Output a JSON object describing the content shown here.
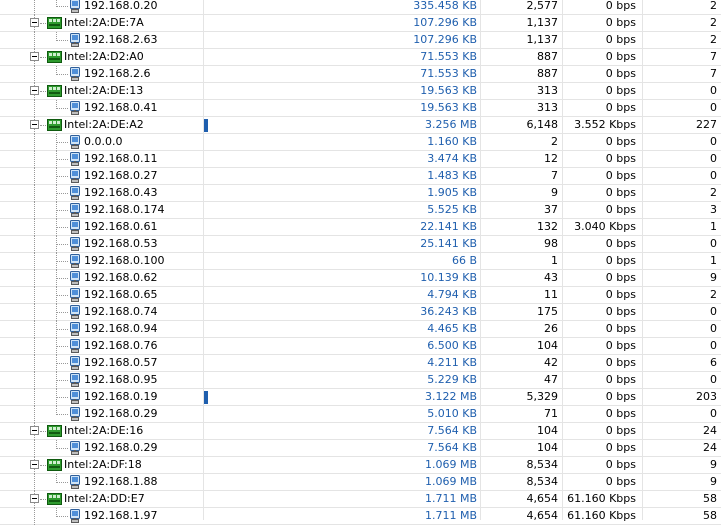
{
  "rows": [
    {
      "type": "host",
      "name": "192.168.0.20",
      "bytes": "335.458 KB",
      "packets": "2,577",
      "bps": "0 bps",
      "last": "2",
      "bar": false
    },
    {
      "type": "group",
      "name": "Intel:2A:DE:7A",
      "bytes": "107.296 KB",
      "packets": "1,137",
      "bps": "0 bps",
      "last": "2",
      "bar": false
    },
    {
      "type": "host",
      "name": "192.168.2.63",
      "bytes": "107.296 KB",
      "packets": "1,137",
      "bps": "0 bps",
      "last": "2",
      "bar": false
    },
    {
      "type": "group",
      "name": "Intel:2A:D2:A0",
      "bytes": "71.553 KB",
      "packets": "887",
      "bps": "0 bps",
      "last": "7",
      "bar": false
    },
    {
      "type": "host",
      "name": "192.168.2.6",
      "bytes": "71.553 KB",
      "packets": "887",
      "bps": "0 bps",
      "last": "7",
      "bar": false
    },
    {
      "type": "group",
      "name": "Intel:2A:DE:13",
      "bytes": "19.563 KB",
      "packets": "313",
      "bps": "0 bps",
      "last": "0",
      "bar": false
    },
    {
      "type": "host",
      "name": "192.168.0.41",
      "bytes": "19.563 KB",
      "packets": "313",
      "bps": "0 bps",
      "last": "0",
      "bar": false
    },
    {
      "type": "group",
      "name": "Intel:2A:DE:A2",
      "bytes": "3.256 MB",
      "packets": "6,148",
      "bps": "3.552 Kbps",
      "last": "227",
      "bar": true
    },
    {
      "type": "host",
      "name": "0.0.0.0",
      "bytes": "1.160 KB",
      "packets": "2",
      "bps": "0 bps",
      "last": "0",
      "bar": false
    },
    {
      "type": "host",
      "name": "192.168.0.11",
      "bytes": "3.474 KB",
      "packets": "12",
      "bps": "0 bps",
      "last": "0",
      "bar": false
    },
    {
      "type": "host",
      "name": "192.168.0.27",
      "bytes": "1.483 KB",
      "packets": "7",
      "bps": "0 bps",
      "last": "0",
      "bar": false
    },
    {
      "type": "host",
      "name": "192.168.0.43",
      "bytes": "1.905 KB",
      "packets": "9",
      "bps": "0 bps",
      "last": "2",
      "bar": false
    },
    {
      "type": "host",
      "name": "192.168.0.174",
      "bytes": "5.525 KB",
      "packets": "37",
      "bps": "0 bps",
      "last": "3",
      "bar": false
    },
    {
      "type": "host",
      "name": "192.168.0.61",
      "bytes": "22.141 KB",
      "packets": "132",
      "bps": "3.040 Kbps",
      "last": "1",
      "bar": false
    },
    {
      "type": "host",
      "name": "192.168.0.53",
      "bytes": "25.141 KB",
      "packets": "98",
      "bps": "0 bps",
      "last": "0",
      "bar": false
    },
    {
      "type": "host",
      "name": "192.168.0.100",
      "bytes": "66  B",
      "packets": "1",
      "bps": "0 bps",
      "last": "1",
      "bar": false
    },
    {
      "type": "host",
      "name": "192.168.0.62",
      "bytes": "10.139 KB",
      "packets": "43",
      "bps": "0 bps",
      "last": "9",
      "bar": false
    },
    {
      "type": "host",
      "name": "192.168.0.65",
      "bytes": "4.794 KB",
      "packets": "11",
      "bps": "0 bps",
      "last": "2",
      "bar": false
    },
    {
      "type": "host",
      "name": "192.168.0.74",
      "bytes": "36.243 KB",
      "packets": "175",
      "bps": "0 bps",
      "last": "0",
      "bar": false
    },
    {
      "type": "host",
      "name": "192.168.0.94",
      "bytes": "4.465 KB",
      "packets": "26",
      "bps": "0 bps",
      "last": "0",
      "bar": false
    },
    {
      "type": "host",
      "name": "192.168.0.76",
      "bytes": "6.500 KB",
      "packets": "104",
      "bps": "0 bps",
      "last": "0",
      "bar": false
    },
    {
      "type": "host",
      "name": "192.168.0.57",
      "bytes": "4.211 KB",
      "packets": "42",
      "bps": "0 bps",
      "last": "6",
      "bar": false
    },
    {
      "type": "host",
      "name": "192.168.0.95",
      "bytes": "5.229 KB",
      "packets": "47",
      "bps": "0 bps",
      "last": "0",
      "bar": false
    },
    {
      "type": "host",
      "name": "192.168.0.19",
      "bytes": "3.122 MB",
      "packets": "5,329",
      "bps": "0 bps",
      "last": "203",
      "bar": true
    },
    {
      "type": "host",
      "name": "192.168.0.29",
      "bytes": "5.010 KB",
      "packets": "71",
      "bps": "0 bps",
      "last": "0",
      "bar": false
    },
    {
      "type": "group",
      "name": "Intel:2A:DE:16",
      "bytes": "7.564 KB",
      "packets": "104",
      "bps": "0 bps",
      "last": "24",
      "bar": false
    },
    {
      "type": "host",
      "name": "192.168.0.29",
      "bytes": "7.564 KB",
      "packets": "104",
      "bps": "0 bps",
      "last": "24",
      "bar": false
    },
    {
      "type": "group",
      "name": "Intel:2A:DF:18",
      "bytes": "1.069 MB",
      "packets": "8,534",
      "bps": "0 bps",
      "last": "9",
      "bar": false
    },
    {
      "type": "host",
      "name": "192.168.1.88",
      "bytes": "1.069 MB",
      "packets": "8,534",
      "bps": "0 bps",
      "last": "9",
      "bar": false
    },
    {
      "type": "group",
      "name": "Intel:2A:DD:E7",
      "bytes": "1.711 MB",
      "packets": "4,654",
      "bps": "61.160 Kbps",
      "last": "58",
      "bar": false
    },
    {
      "type": "host",
      "name": "192.168.1.97",
      "bytes": "1.711 MB",
      "packets": "4,654",
      "bps": "61.160 Kbps",
      "last": "58",
      "bar": false
    }
  ],
  "icons": {
    "group": "network-adapter-icon",
    "host": "computer-icon",
    "expander": "collapse-minus-icon"
  },
  "colors": {
    "bytes_text": "#1f5fae",
    "activity_bar": "#1f5fae",
    "nic_green": "#2e9a2e"
  }
}
